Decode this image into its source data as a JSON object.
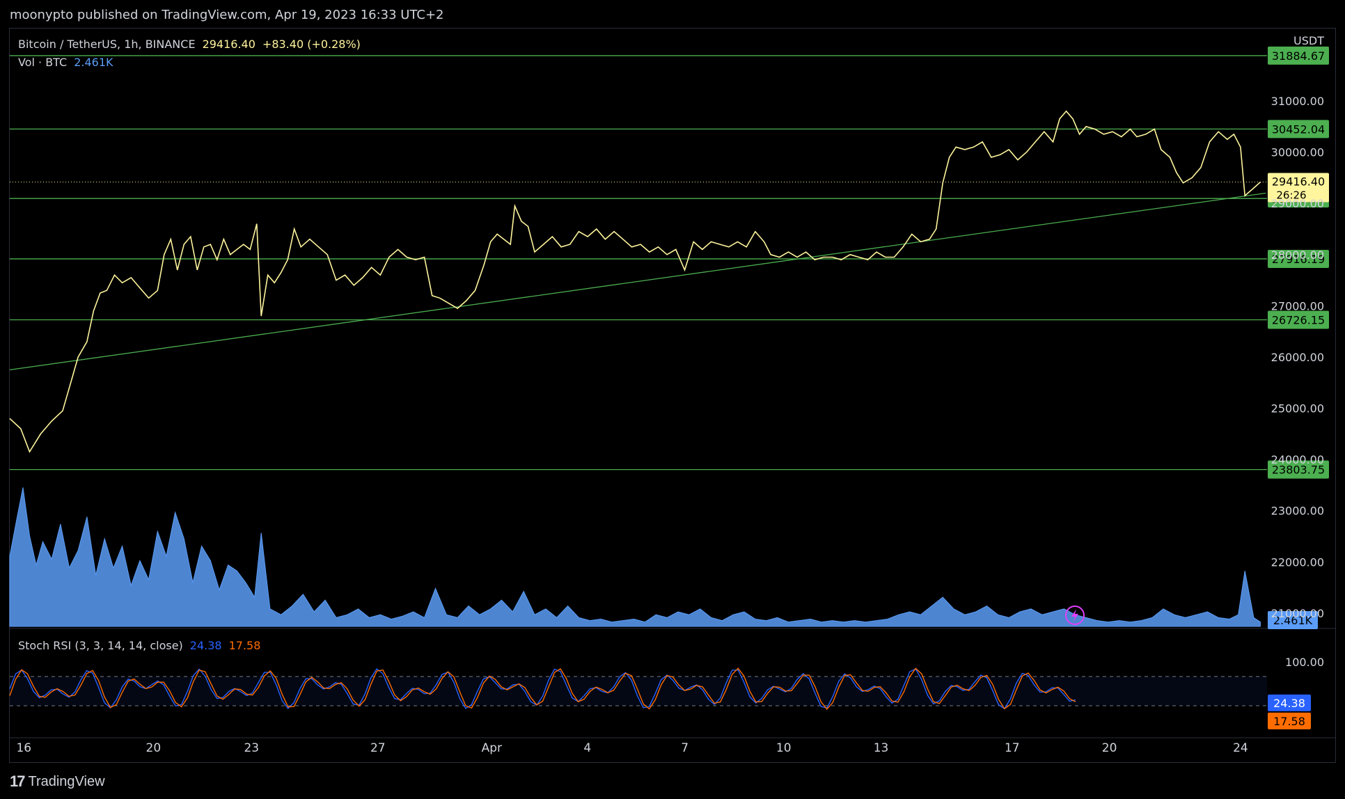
{
  "header": {
    "published": "moonypto published on TradingView.com, Apr 19, 2023 16:33 UTC+2"
  },
  "legend": {
    "symbol": "Bitcoin / TetherUS, 1h, BINANCE",
    "price": "29416.40",
    "change": "+83.40 (+0.28%)",
    "vol_label": "Vol · BTC",
    "vol_value": "2.461K",
    "stoch_label": "Stoch RSI (3, 3, 14, 14, close)",
    "stoch_k": "24.38",
    "stoch_d": "17.58"
  },
  "branding": {
    "logo": "17",
    "name": "TradingView"
  },
  "colors": {
    "background": "#000000",
    "price_line": "#fff59d",
    "levels": "#4caf50",
    "volume": "#5b9cf6",
    "stoch_k": "#2962ff",
    "stoch_d": "#ff6d00",
    "text": "#d1d4dc"
  },
  "chart_data": {
    "type": "line",
    "currency": "USDT",
    "x_ticks": [
      "16",
      "20",
      "23",
      "27",
      "Apr",
      "4",
      "7",
      "10",
      "13",
      "17",
      "20",
      "24"
    ],
    "y_ticks": [
      "31000.00",
      "30000.00",
      "29000.00",
      "28000.00",
      "27000.00",
      "26000.00",
      "25000.00",
      "24000.00",
      "23000.00",
      "22000.00",
      "21000.00"
    ],
    "ylim": [
      20700,
      32400
    ],
    "horizontal_levels": [
      "31884.67",
      "30452.04",
      "29095.68",
      "27916.19",
      "26726.15",
      "23803.75"
    ],
    "current_price": "29416.40",
    "countdown": "26:26",
    "trendline": [
      [
        0,
        25750
      ],
      [
        1.035,
        29200
      ]
    ],
    "price_series": [
      [
        0.0,
        24800
      ],
      [
        0.01,
        24600
      ],
      [
        0.018,
        24150
      ],
      [
        0.028,
        24500
      ],
      [
        0.038,
        24750
      ],
      [
        0.048,
        24950
      ],
      [
        0.056,
        25550
      ],
      [
        0.062,
        26000
      ],
      [
        0.07,
        26300
      ],
      [
        0.076,
        26900
      ],
      [
        0.082,
        27250
      ],
      [
        0.088,
        27300
      ],
      [
        0.095,
        27600
      ],
      [
        0.102,
        27450
      ],
      [
        0.11,
        27550
      ],
      [
        0.118,
        27350
      ],
      [
        0.126,
        27150
      ],
      [
        0.134,
        27300
      ],
      [
        0.14,
        28000
      ],
      [
        0.146,
        28300
      ],
      [
        0.152,
        27700
      ],
      [
        0.158,
        28200
      ],
      [
        0.164,
        28350
      ],
      [
        0.17,
        27700
      ],
      [
        0.176,
        28150
      ],
      [
        0.182,
        28200
      ],
      [
        0.188,
        27900
      ],
      [
        0.194,
        28300
      ],
      [
        0.2,
        28000
      ],
      [
        0.206,
        28100
      ],
      [
        0.212,
        28200
      ],
      [
        0.218,
        28100
      ],
      [
        0.224,
        28600
      ],
      [
        0.228,
        26800
      ],
      [
        0.234,
        27600
      ],
      [
        0.24,
        27450
      ],
      [
        0.246,
        27650
      ],
      [
        0.252,
        27900
      ],
      [
        0.258,
        28500
      ],
      [
        0.264,
        28150
      ],
      [
        0.272,
        28300
      ],
      [
        0.28,
        28150
      ],
      [
        0.288,
        28000
      ],
      [
        0.296,
        27500
      ],
      [
        0.304,
        27600
      ],
      [
        0.312,
        27400
      ],
      [
        0.32,
        27550
      ],
      [
        0.328,
        27750
      ],
      [
        0.336,
        27600
      ],
      [
        0.344,
        27950
      ],
      [
        0.352,
        28100
      ],
      [
        0.36,
        27950
      ],
      [
        0.368,
        27900
      ],
      [
        0.376,
        27950
      ],
      [
        0.383,
        27200
      ],
      [
        0.39,
        27150
      ],
      [
        0.398,
        27050
      ],
      [
        0.406,
        26950
      ],
      [
        0.414,
        27100
      ],
      [
        0.422,
        27300
      ],
      [
        0.43,
        27800
      ],
      [
        0.436,
        28250
      ],
      [
        0.442,
        28400
      ],
      [
        0.448,
        28300
      ],
      [
        0.454,
        28200
      ],
      [
        0.458,
        28950
      ],
      [
        0.464,
        28650
      ],
      [
        0.47,
        28550
      ],
      [
        0.476,
        28050
      ],
      [
        0.484,
        28200
      ],
      [
        0.492,
        28350
      ],
      [
        0.5,
        28150
      ],
      [
        0.508,
        28200
      ],
      [
        0.516,
        28450
      ],
      [
        0.524,
        28350
      ],
      [
        0.532,
        28500
      ],
      [
        0.54,
        28300
      ],
      [
        0.548,
        28450
      ],
      [
        0.556,
        28300
      ],
      [
        0.564,
        28150
      ],
      [
        0.572,
        28200
      ],
      [
        0.58,
        28050
      ],
      [
        0.588,
        28150
      ],
      [
        0.596,
        28000
      ],
      [
        0.604,
        28100
      ],
      [
        0.612,
        27700
      ],
      [
        0.62,
        28250
      ],
      [
        0.628,
        28100
      ],
      [
        0.636,
        28250
      ],
      [
        0.644,
        28200
      ],
      [
        0.652,
        28150
      ],
      [
        0.66,
        28250
      ],
      [
        0.668,
        28150
      ],
      [
        0.676,
        28450
      ],
      [
        0.684,
        28250
      ],
      [
        0.69,
        28000
      ],
      [
        0.698,
        27950
      ],
      [
        0.706,
        28050
      ],
      [
        0.714,
        27950
      ],
      [
        0.722,
        28050
      ],
      [
        0.73,
        27900
      ],
      [
        0.738,
        27950
      ],
      [
        0.746,
        27950
      ],
      [
        0.754,
        27900
      ],
      [
        0.762,
        28000
      ],
      [
        0.77,
        27950
      ],
      [
        0.778,
        27900
      ],
      [
        0.786,
        28050
      ],
      [
        0.794,
        27950
      ],
      [
        0.802,
        27950
      ],
      [
        0.81,
        28150
      ],
      [
        0.818,
        28400
      ],
      [
        0.826,
        28250
      ],
      [
        0.834,
        28300
      ],
      [
        0.84,
        28500
      ],
      [
        0.846,
        29400
      ],
      [
        0.852,
        29900
      ],
      [
        0.858,
        30100
      ],
      [
        0.866,
        30050
      ],
      [
        0.874,
        30100
      ],
      [
        0.882,
        30200
      ],
      [
        0.89,
        29900
      ],
      [
        0.898,
        29950
      ],
      [
        0.906,
        30050
      ],
      [
        0.914,
        29850
      ],
      [
        0.922,
        30000
      ],
      [
        0.93,
        30200
      ],
      [
        0.938,
        30400
      ],
      [
        0.946,
        30200
      ],
      [
        0.952,
        30650
      ],
      [
        0.958,
        30800
      ],
      [
        0.964,
        30650
      ],
      [
        0.97,
        30350
      ],
      [
        0.976,
        30500
      ],
      [
        0.984,
        30450
      ],
      [
        0.992,
        30350
      ],
      [
        1.0,
        30400
      ],
      [
        1.008,
        30300
      ],
      [
        1.016,
        30450
      ],
      [
        1.022,
        30300
      ],
      [
        1.03,
        30350
      ],
      [
        1.038,
        30450
      ],
      [
        1.044,
        30050
      ],
      [
        1.052,
        29900
      ],
      [
        1.058,
        29600
      ],
      [
        1.064,
        29400
      ],
      [
        1.072,
        29500
      ],
      [
        1.08,
        29700
      ],
      [
        1.088,
        30200
      ],
      [
        1.096,
        30400
      ],
      [
        1.104,
        30250
      ],
      [
        1.11,
        30350
      ],
      [
        1.116,
        30100
      ],
      [
        1.12,
        29150
      ],
      [
        1.128,
        29300
      ],
      [
        1.134,
        29416
      ]
    ],
    "volume_series": [
      [
        0.0,
        48
      ],
      [
        0.006,
        72
      ],
      [
        0.012,
        95
      ],
      [
        0.018,
        62
      ],
      [
        0.024,
        42
      ],
      [
        0.03,
        58
      ],
      [
        0.038,
        46
      ],
      [
        0.046,
        70
      ],
      [
        0.054,
        40
      ],
      [
        0.062,
        52
      ],
      [
        0.07,
        75
      ],
      [
        0.078,
        35
      ],
      [
        0.086,
        60
      ],
      [
        0.094,
        40
      ],
      [
        0.102,
        55
      ],
      [
        0.11,
        28
      ],
      [
        0.118,
        45
      ],
      [
        0.126,
        32
      ],
      [
        0.134,
        65
      ],
      [
        0.142,
        48
      ],
      [
        0.15,
        78
      ],
      [
        0.158,
        60
      ],
      [
        0.166,
        30
      ],
      [
        0.174,
        55
      ],
      [
        0.182,
        45
      ],
      [
        0.19,
        25
      ],
      [
        0.198,
        42
      ],
      [
        0.206,
        38
      ],
      [
        0.214,
        30
      ],
      [
        0.222,
        20
      ],
      [
        0.228,
        64
      ],
      [
        0.236,
        12
      ],
      [
        0.246,
        8
      ],
      [
        0.256,
        14
      ],
      [
        0.266,
        22
      ],
      [
        0.276,
        10
      ],
      [
        0.286,
        18
      ],
      [
        0.296,
        6
      ],
      [
        0.306,
        8
      ],
      [
        0.316,
        12
      ],
      [
        0.326,
        6
      ],
      [
        0.336,
        8
      ],
      [
        0.346,
        5
      ],
      [
        0.356,
        7
      ],
      [
        0.366,
        10
      ],
      [
        0.376,
        6
      ],
      [
        0.386,
        26
      ],
      [
        0.396,
        8
      ],
      [
        0.406,
        6
      ],
      [
        0.416,
        14
      ],
      [
        0.426,
        8
      ],
      [
        0.436,
        12
      ],
      [
        0.446,
        18
      ],
      [
        0.456,
        10
      ],
      [
        0.466,
        24
      ],
      [
        0.476,
        8
      ],
      [
        0.486,
        12
      ],
      [
        0.496,
        6
      ],
      [
        0.506,
        14
      ],
      [
        0.516,
        6
      ],
      [
        0.526,
        4
      ],
      [
        0.536,
        5
      ],
      [
        0.546,
        3
      ],
      [
        0.556,
        4
      ],
      [
        0.566,
        5
      ],
      [
        0.576,
        3
      ],
      [
        0.586,
        8
      ],
      [
        0.596,
        6
      ],
      [
        0.606,
        10
      ],
      [
        0.616,
        8
      ],
      [
        0.626,
        12
      ],
      [
        0.636,
        6
      ],
      [
        0.646,
        4
      ],
      [
        0.656,
        8
      ],
      [
        0.666,
        10
      ],
      [
        0.676,
        5
      ],
      [
        0.686,
        4
      ],
      [
        0.696,
        6
      ],
      [
        0.706,
        3
      ],
      [
        0.716,
        4
      ],
      [
        0.726,
        5
      ],
      [
        0.736,
        3
      ],
      [
        0.746,
        4
      ],
      [
        0.756,
        3
      ],
      [
        0.766,
        4
      ],
      [
        0.776,
        3
      ],
      [
        0.786,
        4
      ],
      [
        0.796,
        5
      ],
      [
        0.806,
        8
      ],
      [
        0.816,
        10
      ],
      [
        0.826,
        8
      ],
      [
        0.836,
        14
      ],
      [
        0.846,
        20
      ],
      [
        0.856,
        12
      ],
      [
        0.866,
        8
      ],
      [
        0.876,
        10
      ],
      [
        0.886,
        14
      ],
      [
        0.896,
        8
      ],
      [
        0.906,
        6
      ],
      [
        0.916,
        10
      ],
      [
        0.926,
        12
      ],
      [
        0.936,
        8
      ],
      [
        0.946,
        10
      ],
      [
        0.956,
        12
      ],
      [
        0.966,
        8
      ],
      [
        0.976,
        6
      ],
      [
        0.986,
        4
      ],
      [
        0.996,
        3
      ],
      [
        1.006,
        4
      ],
      [
        1.016,
        3
      ],
      [
        1.026,
        4
      ],
      [
        1.036,
        6
      ],
      [
        1.046,
        12
      ],
      [
        1.056,
        8
      ],
      [
        1.066,
        6
      ],
      [
        1.076,
        8
      ],
      [
        1.086,
        10
      ],
      [
        1.096,
        6
      ],
      [
        1.106,
        5
      ],
      [
        1.114,
        8
      ],
      [
        1.12,
        38
      ],
      [
        1.128,
        6
      ],
      [
        1.134,
        3
      ]
    ],
    "stoch_rsi": {
      "ylim": [
        0,
        100
      ],
      "upper_band": "100.00",
      "band_levels": [
        80,
        20
      ],
      "k_value": "24.38",
      "d_value": "17.58"
    }
  }
}
